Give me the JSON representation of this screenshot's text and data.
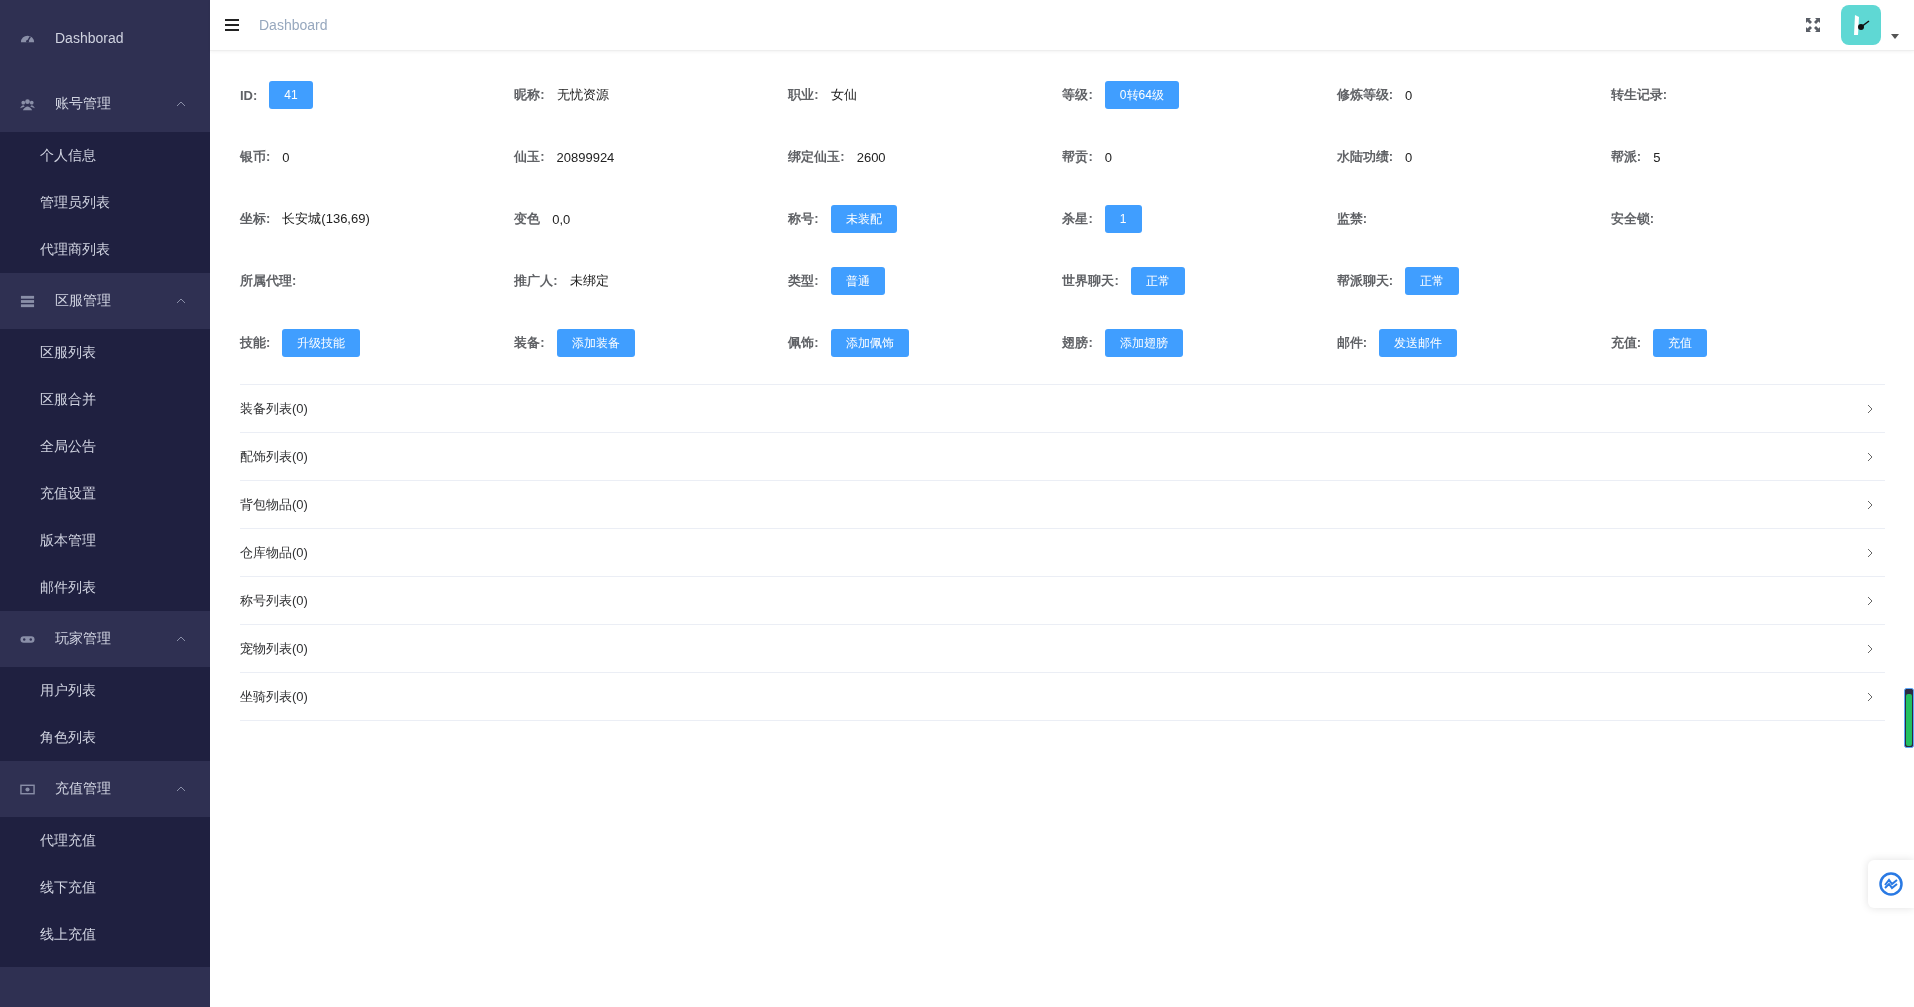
{
  "sidebar": {
    "items": [
      {
        "kind": "link",
        "label": "Dashborad"
      },
      {
        "kind": "group",
        "label": "账号管理",
        "expanded": true,
        "children": [
          {
            "label": "个人信息"
          },
          {
            "label": "管理员列表"
          },
          {
            "label": "代理商列表"
          }
        ]
      },
      {
        "kind": "group",
        "label": "区服管理",
        "expanded": true,
        "children": [
          {
            "label": "区服列表"
          },
          {
            "label": "区服合并"
          },
          {
            "label": "全局公告"
          },
          {
            "label": "充值设置"
          },
          {
            "label": "版本管理"
          },
          {
            "label": "邮件列表"
          }
        ]
      },
      {
        "kind": "group",
        "label": "玩家管理",
        "expanded": true,
        "children": [
          {
            "label": "用户列表"
          },
          {
            "label": "角色列表"
          }
        ]
      },
      {
        "kind": "group",
        "label": "充值管理",
        "expanded": true,
        "children": [
          {
            "label": "代理充值"
          },
          {
            "label": "线下充值"
          },
          {
            "label": "线上充值"
          }
        ]
      }
    ]
  },
  "header": {
    "breadcrumb": "Dashboard"
  },
  "info_rows": [
    [
      {
        "kind": "tag",
        "label": "ID:",
        "value": "41"
      },
      {
        "kind": "text",
        "label": "昵称:",
        "value": "无忧资源"
      },
      {
        "kind": "text",
        "label": "职业:",
        "value": "女仙"
      },
      {
        "kind": "tag",
        "label": "等级:",
        "value": "0转64级"
      },
      {
        "kind": "text",
        "label": "修炼等级:",
        "value": "0"
      },
      {
        "kind": "empty",
        "label": "转生记录:"
      }
    ],
    [
      {
        "kind": "text",
        "label": "银币:",
        "value": "0"
      },
      {
        "kind": "text",
        "label": "仙玉:",
        "value": "20899924"
      },
      {
        "kind": "text",
        "label": "绑定仙玉:",
        "value": "2600"
      },
      {
        "kind": "text",
        "label": "帮贡:",
        "value": "0"
      },
      {
        "kind": "text",
        "label": "水陆功绩:",
        "value": "0"
      },
      {
        "kind": "text",
        "label": "帮派:",
        "value": "5"
      }
    ],
    [
      {
        "kind": "text",
        "label": "坐标:",
        "value": "长安城(136,69)"
      },
      {
        "kind": "text",
        "label": "变色",
        "value": "0,0"
      },
      {
        "kind": "tag",
        "label": "称号:",
        "value": "未装配"
      },
      {
        "kind": "tag",
        "label": "杀星:",
        "value": "1"
      },
      {
        "kind": "empty",
        "label": "监禁:"
      },
      {
        "kind": "empty",
        "label": "安全锁:"
      }
    ],
    [
      {
        "kind": "empty",
        "label": "所属代理:"
      },
      {
        "kind": "text",
        "label": "推广人:",
        "value": "未绑定"
      },
      {
        "kind": "tag",
        "label": "类型:",
        "value": "普通"
      },
      {
        "kind": "tag",
        "label": "世界聊天:",
        "value": "正常"
      },
      {
        "kind": "tag",
        "label": "帮派聊天:",
        "value": "正常"
      }
    ],
    [
      {
        "kind": "button",
        "label": "技能:",
        "value": "升级技能"
      },
      {
        "kind": "button",
        "label": "装备:",
        "value": "添加装备"
      },
      {
        "kind": "button",
        "label": "佩饰:",
        "value": "添加佩饰"
      },
      {
        "kind": "button",
        "label": "翅膀:",
        "value": "添加翅膀"
      },
      {
        "kind": "button",
        "label": "邮件:",
        "value": "发送邮件"
      },
      {
        "kind": "button",
        "label": "充值:",
        "value": "充值"
      }
    ]
  ],
  "collapse": [
    {
      "title": "装备列表(0)",
      "expanded": false
    },
    {
      "title": "配饰列表(0)",
      "expanded": false
    },
    {
      "title": "背包物品(0)",
      "expanded": false
    },
    {
      "title": "仓库物品(0)",
      "expanded": false
    },
    {
      "title": "称号列表(0)",
      "expanded": false
    },
    {
      "title": "宠物列表(0)",
      "expanded": false
    },
    {
      "title": "坐骑列表(0)",
      "expanded": false
    }
  ]
}
